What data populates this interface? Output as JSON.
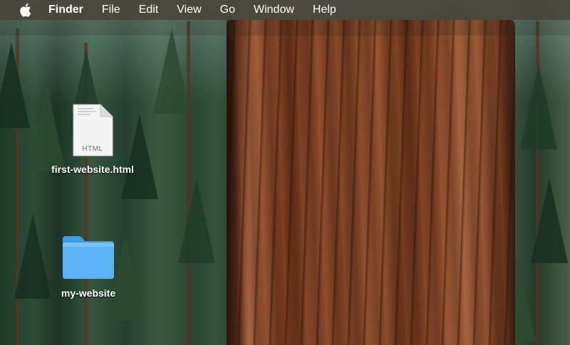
{
  "menubar": {
    "apple_icon": "apple-icon",
    "items": [
      "Finder",
      "File",
      "Edit",
      "View",
      "Go",
      "Window",
      "Help"
    ]
  },
  "desktop": {
    "icons": [
      {
        "label": "first-website.html",
        "icon": "html-document-icon",
        "badge": "HTML"
      },
      {
        "label": "my-website",
        "icon": "folder-icon"
      }
    ]
  },
  "colors": {
    "menubar_bg": "#48443a",
    "folder_blue": "#5ab2f4",
    "label_text": "#ffffff"
  }
}
